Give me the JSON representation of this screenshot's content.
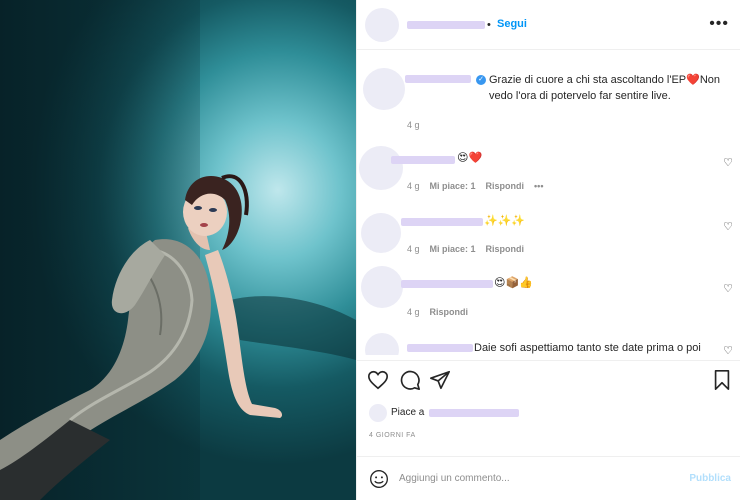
{
  "header": {
    "dot": "•",
    "follow_label": "Segui",
    "more_icon": "more-horizontal-icon",
    "more_glyph": "•••"
  },
  "comments": [
    {
      "text": "Grazie di cuore a chi sta ascoltando l'EP❤️Non vedo l'ora di potervelo far sentire live.",
      "time": "4 g"
    },
    {
      "text": "😍❤️",
      "time": "4 g",
      "likes": "Mi piace: 1",
      "reply": "Rispondi",
      "options_glyph": "•••"
    },
    {
      "text": "✨✨✨",
      "time": "4 g",
      "likes": "Mi piace: 1",
      "reply": "Rispondi"
    },
    {
      "text": "😍📦👍",
      "time": "4 g",
      "reply": "Rispondi"
    },
    {
      "text": "Daie sofi aspettiamo tanto ste date prima o poi"
    }
  ],
  "likes": {
    "prefix": "Piace a"
  },
  "date": "4 GIORNI FA",
  "add_comment": {
    "placeholder": "Aggiungi un commento...",
    "publish": "Pubblica"
  },
  "colors": {
    "follow": "#0095f6",
    "publish_disabled": "#b2dffc",
    "meta": "#8e8e8e",
    "blur": "#ddd4f5"
  }
}
